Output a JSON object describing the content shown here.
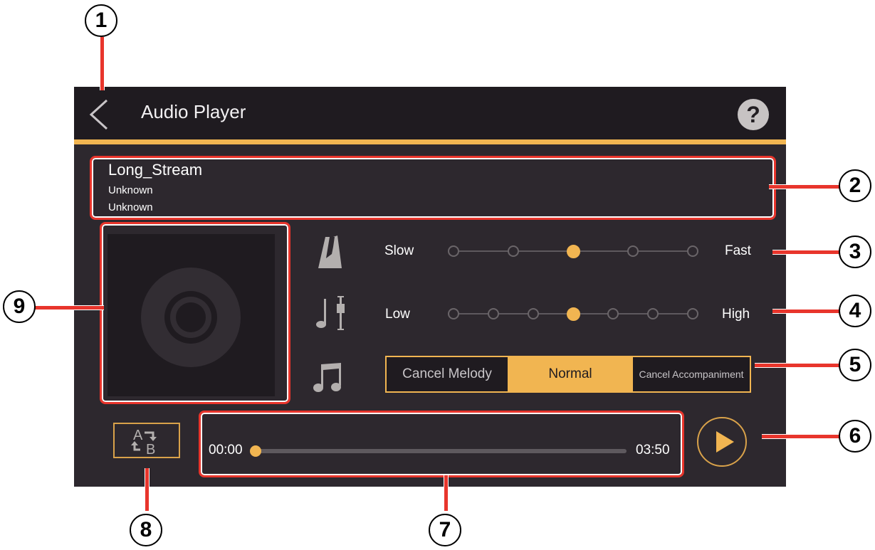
{
  "header": {
    "title": "Audio Player",
    "back_icon": "chevron-left-icon",
    "help_label": "?"
  },
  "song": {
    "title": "Long_Stream",
    "artist": "Unknown",
    "album": "Unknown"
  },
  "tempo": {
    "icon": "metronome-icon",
    "min_label": "Slow",
    "max_label": "Fast",
    "steps": 5,
    "selected_index": 2
  },
  "key": {
    "icon": "note-pitch-icon",
    "min_label": "Low",
    "max_label": "High",
    "steps": 7,
    "selected_index": 3
  },
  "part": {
    "icon": "music-notes-icon",
    "options": [
      "Cancel Melody",
      "Normal",
      "Cancel Accompaniment"
    ],
    "selected": "Normal"
  },
  "playback": {
    "current_time": "00:00",
    "total_time": "03:50",
    "progress": 0,
    "ab_repeat_label_a": "A",
    "ab_repeat_label_b": "B",
    "play_icon": "play-icon"
  },
  "callouts": [
    "1",
    "2",
    "3",
    "4",
    "5",
    "6",
    "7",
    "8",
    "9"
  ],
  "colors": {
    "accent": "#f1b551",
    "background": "#2d282e",
    "titlebar": "#1f1b20",
    "callout": "#e8352c"
  }
}
